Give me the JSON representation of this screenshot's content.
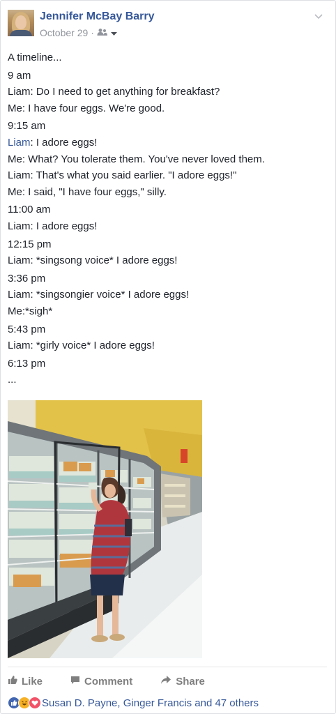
{
  "post": {
    "author": "Jennifer McBay Barry",
    "date": "October 29",
    "meta_separator": "·",
    "text_lines": [
      {
        "kind": "plain",
        "text": "A timeline..."
      },
      {
        "kind": "time",
        "text": "9 am"
      },
      {
        "kind": "plain",
        "text": "Liam: Do I need to get anything for breakfast?"
      },
      {
        "kind": "plain",
        "text": "Me: I have four eggs. We're good."
      },
      {
        "kind": "time",
        "text": "9:15 am"
      },
      {
        "kind": "mention",
        "name": "Liam",
        "rest": ": I adore eggs!"
      },
      {
        "kind": "plain",
        "text": "Me: What? You tolerate them. You've never loved them."
      },
      {
        "kind": "plain",
        "text": "Liam: That's what you said earlier. \"I adore eggs!\""
      },
      {
        "kind": "plain",
        "text": "Me: I said, \"I have four eggs,\" silly."
      },
      {
        "kind": "time",
        "text": "11:00 am"
      },
      {
        "kind": "plain",
        "text": "Liam: I adore eggs!"
      },
      {
        "kind": "time",
        "text": "12:15 pm"
      },
      {
        "kind": "plain",
        "text": "Liam: *singsong voice* I adore eggs!"
      },
      {
        "kind": "time",
        "text": "3:36 pm"
      },
      {
        "kind": "plain",
        "text": "Liam: *singsongier voice* I adore eggs!"
      },
      {
        "kind": "plain",
        "text": "Me:*sigh*"
      },
      {
        "kind": "time",
        "text": "5:43 pm"
      },
      {
        "kind": "plain",
        "text": "Liam: *girly voice* I adore eggs!"
      },
      {
        "kind": "time",
        "text": "6:13 pm"
      },
      {
        "kind": "plain",
        "text": "..."
      }
    ]
  },
  "actions": {
    "like": "Like",
    "comment": "Comment",
    "share": "Share"
  },
  "reactions": {
    "summary": "Susan D. Payne, Ginger Francis and 47 others",
    "icons": [
      "like-reaction-icon",
      "haha-reaction-icon",
      "love-reaction-icon"
    ]
  },
  "colors": {
    "link": "#365899",
    "meta": "#90949c",
    "action": "#7f7f7f",
    "wall": "#e8c84a"
  },
  "icons": {
    "audience": "friends-audience-icon",
    "caret": "caret-down-icon",
    "options": "chevron-down-icon",
    "like": "thumbs-up-icon",
    "comment": "comment-bubble-icon",
    "share": "share-arrow-icon"
  }
}
